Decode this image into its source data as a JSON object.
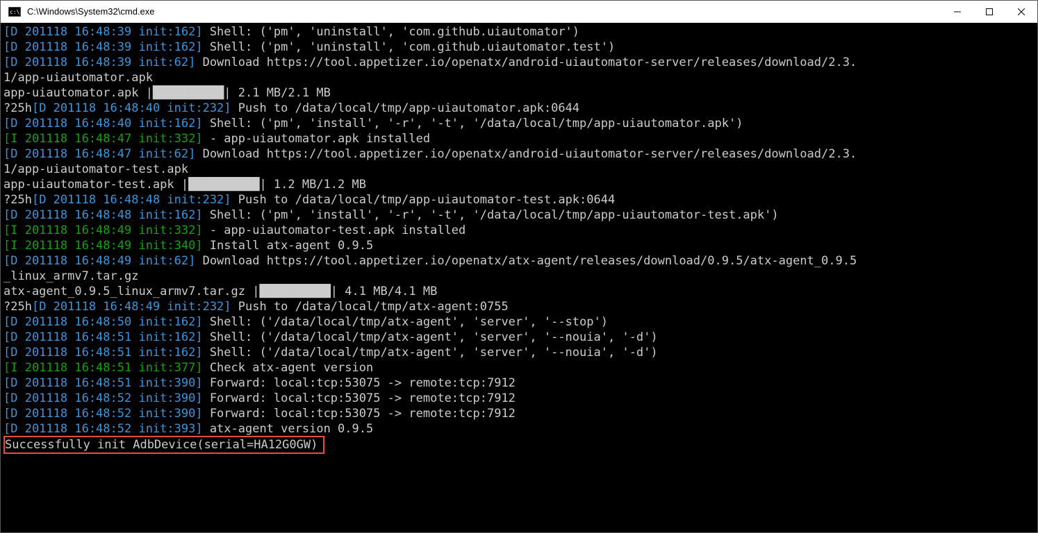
{
  "titlebar": {
    "title": "C:\\Windows\\System32\\cmd.exe"
  },
  "lines": {
    "l1": "[D 201118 16:48:39 init:162]",
    "l1t": " Shell: ('pm', 'uninstall', 'com.github.uiautomator')",
    "l2": "[D 201118 16:48:39 init:162]",
    "l2t": " Shell: ('pm', 'uninstall', 'com.github.uiautomator.test')",
    "l3": "[D 201118 16:48:39 init:62]",
    "l3t": " Download https://tool.appetizer.io/openatx/android-uiautomator-server/releases/download/2.3.",
    "l3b": "1/app-uiautomator.apk",
    "l4": "app-uiautomator.apk |██████████| 2.1 MB/2.1 MB",
    "l5a": "\u001b?25h",
    "l5": "[D 201118 16:48:40 init:232]",
    "l5t": " Push to /data/local/tmp/app-uiautomator.apk:0644",
    "l6": "[D 201118 16:48:40 init:162]",
    "l6t": " Shell: ('pm', 'install', '-r', '-t', '/data/local/tmp/app-uiautomator.apk')",
    "l7": "[I 201118 16:48:47 init:332]",
    "l7t": " - app-uiautomator.apk installed",
    "l8": "[D 201118 16:48:47 init:62]",
    "l8t": " Download https://tool.appetizer.io/openatx/android-uiautomator-server/releases/download/2.3.",
    "l8b": "1/app-uiautomator-test.apk",
    "l9": "app-uiautomator-test.apk |██████████| 1.2 MB/1.2 MB",
    "l10a": "\u001b?25h",
    "l10": "[D 201118 16:48:48 init:232]",
    "l10t": " Push to /data/local/tmp/app-uiautomator-test.apk:0644",
    "l11": "[D 201118 16:48:48 init:162]",
    "l11t": " Shell: ('pm', 'install', '-r', '-t', '/data/local/tmp/app-uiautomator-test.apk')",
    "l12": "[I 201118 16:48:49 init:332]",
    "l12t": " - app-uiautomator-test.apk installed",
    "l13": "[I 201118 16:48:49 init:340]",
    "l13t": " Install atx-agent 0.9.5",
    "l14": "[D 201118 16:48:49 init:62]",
    "l14t": " Download https://tool.appetizer.io/openatx/atx-agent/releases/download/0.9.5/atx-agent_0.9.5",
    "l14b": "_linux_armv7.tar.gz",
    "l15": "atx-agent_0.9.5_linux_armv7.tar.gz |██████████| 4.1 MB/4.1 MB",
    "l16a": "\u001b?25h",
    "l16": "[D 201118 16:48:49 init:232]",
    "l16t": " Push to /data/local/tmp/atx-agent:0755",
    "l17": "[D 201118 16:48:50 init:162]",
    "l17t": " Shell: ('/data/local/tmp/atx-agent', 'server', '--stop')",
    "l18": "[D 201118 16:48:51 init:162]",
    "l18t": " Shell: ('/data/local/tmp/atx-agent', 'server', '--nouia', '-d')",
    "l19": "[D 201118 16:48:51 init:162]",
    "l19t": " Shell: ('/data/local/tmp/atx-agent', 'server', '--nouia', '-d')",
    "l20": "[I 201118 16:48:51 init:377]",
    "l20t": " Check atx-agent version",
    "l21": "[D 201118 16:48:51 init:390]",
    "l21t": " Forward: local:tcp:53075 -> remote:tcp:7912",
    "l22": "[D 201118 16:48:52 init:390]",
    "l22t": " Forward: local:tcp:53075 -> remote:tcp:7912",
    "l23": "[D 201118 16:48:52 init:390]",
    "l23t": " Forward: local:tcp:53075 -> remote:tcp:7912",
    "l24": "[D 201118 16:48:52 init:393]",
    "l24t": " atx-agent version 0.9.5",
    "l25": "Successfully init AdbDevice(serial=HA12G0GW)"
  }
}
